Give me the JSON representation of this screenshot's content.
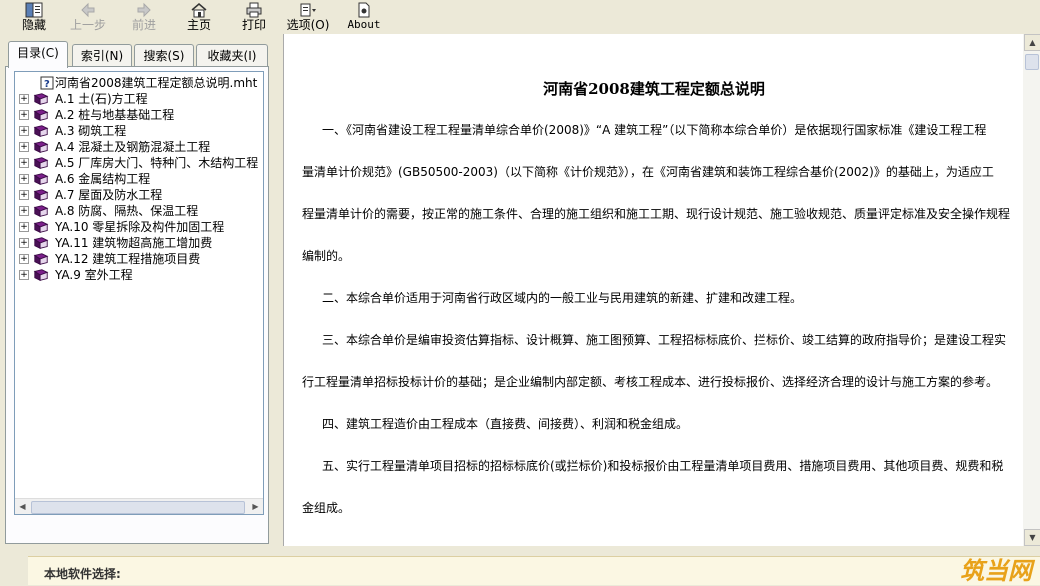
{
  "toolbar": {
    "hide": "隐藏",
    "back": "上一步",
    "forward": "前进",
    "home": "主页",
    "print": "打印",
    "options": "选项(O)",
    "about": "About"
  },
  "tabs": [
    "目录(C)",
    "索引(N)",
    "搜索(S)",
    "收藏夹(I)"
  ],
  "tree": {
    "top_item": "河南省2008建筑工程定额总说明.mht",
    "items": [
      "A.1 土(石)方工程",
      "A.2 桩与地基基础工程",
      "A.3 砌筑工程",
      "A.4 混凝土及钢筋混凝土工程",
      "A.5 厂库房大门、特种门、木结构工程",
      "A.6 金属结构工程",
      "A.7 屋面及防水工程",
      "A.8 防腐、隔热、保温工程",
      "YA.10 零星拆除及构件加固工程",
      "YA.11 建筑物超高施工增加费",
      "YA.12 建筑工程措施项目费",
      "YA.9 室外工程"
    ]
  },
  "document": {
    "title": "河南省2008建筑工程定额总说明",
    "paragraphs": [
      [
        "一、《河南省建设工程工程量清单综合单价(2008)》“A 建筑工程”（以下简称本综合单价）是依据现行国家标准《建设工程工程",
        "量清单计价规范》(GB50500-2003)（以下简称《计价规范》），在《河南省建筑和装饰工程综合基价(2002)》的基础上，为适应工",
        "程量清单计价的需要，按正常的施工条件、合理的施工组织和施工工期、现行设计规范、施工验收规范、质量评定标准及安全操作规程",
        "编制的。"
      ],
      [
        "二、本综合单价适用于河南省行政区域内的一般工业与民用建筑的新建、扩建和改建工程。"
      ],
      [
        "三、本综合单价是编审投资估算指标、设计概算、施工图预算、工程招标标底价、拦标价、竣工结算的政府指导价；是建设工程实",
        "行工程量清单招标投标计价的基础；是企业编制内部定额、考核工程成本、进行投标报价、选择经济合理的设计与施工方案的参考。"
      ],
      [
        "四、建筑工程造价由工程成本（直接费、间接费）、利润和税金组成。"
      ],
      [
        "五、实行工程量清单项目招标的招标标底价(或拦标价)和投标报价由工程量清单项目费用、措施项目费用、其他项目费、规费和税",
        "金组成。"
      ]
    ]
  },
  "bottom": {
    "local_software_label": "本地软件选择:",
    "watermark": "筑当网"
  },
  "colors": {
    "book": "#7b1f8a",
    "watermark": "#e8a21a"
  }
}
